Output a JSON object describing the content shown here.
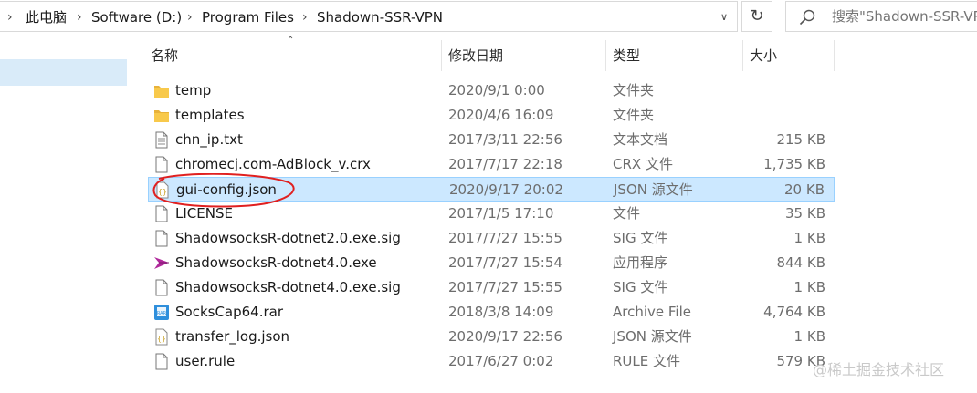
{
  "address_bar": {
    "breadcrumbs": [
      "此电脑",
      "Software (D:)",
      "Program Files",
      "Shadown-SSR-VPN"
    ],
    "search_placeholder": "搜索\"Shadown-SSR-VPN\""
  },
  "columns": {
    "name": "名称",
    "date": "修改日期",
    "type": "类型",
    "size": "大小"
  },
  "files": [
    {
      "name": "temp",
      "date": "2020/9/1 0:00",
      "type": "文件夹",
      "size": "",
      "icon": "folder-icon"
    },
    {
      "name": "templates",
      "date": "2020/4/6 16:09",
      "type": "文件夹",
      "size": "",
      "icon": "folder-icon"
    },
    {
      "name": "chn_ip.txt",
      "date": "2017/3/11 22:56",
      "type": "文本文档",
      "size": "215 KB",
      "icon": "text-file-icon"
    },
    {
      "name": "chromecj.com-AdBlock_v.crx",
      "date": "2017/7/17 22:18",
      "type": "CRX 文件",
      "size": "1,735 KB",
      "icon": "blank-file-icon"
    },
    {
      "name": "gui-config.json",
      "date": "2020/9/17 20:02",
      "type": "JSON 源文件",
      "size": "20 KB",
      "icon": "json-file-icon",
      "selected": true
    },
    {
      "name": "LICENSE",
      "date": "2017/1/5 17:10",
      "type": "文件",
      "size": "35 KB",
      "icon": "blank-file-icon"
    },
    {
      "name": "ShadowsocksR-dotnet2.0.exe.sig",
      "date": "2017/7/27 15:55",
      "type": "SIG 文件",
      "size": "1 KB",
      "icon": "blank-file-icon"
    },
    {
      "name": "ShadowsocksR-dotnet4.0.exe",
      "date": "2017/7/27 15:54",
      "type": "应用程序",
      "size": "844 KB",
      "icon": "paper-plane-icon"
    },
    {
      "name": "ShadowsocksR-dotnet4.0.exe.sig",
      "date": "2017/7/27 15:55",
      "type": "SIG 文件",
      "size": "1 KB",
      "icon": "blank-file-icon"
    },
    {
      "name": "SocksCap64.rar",
      "date": "2018/3/8 14:09",
      "type": "Archive File",
      "size": "4,764 KB",
      "icon": "archive-icon"
    },
    {
      "name": "transfer_log.json",
      "date": "2020/9/17 22:56",
      "type": "JSON 源文件",
      "size": "1 KB",
      "icon": "json-file-icon"
    },
    {
      "name": "user.rule",
      "date": "2017/6/27 0:02",
      "type": "RULE 文件",
      "size": "579 KB",
      "icon": "blank-file-icon"
    }
  ],
  "watermark": "@稀土掘金技术社区",
  "colors": {
    "selection": "#cce8ff",
    "selection_border": "#99d1ff",
    "nav_selection": "#d9ebf9",
    "folder": "#f8c94b",
    "annotation": "#e02020"
  }
}
